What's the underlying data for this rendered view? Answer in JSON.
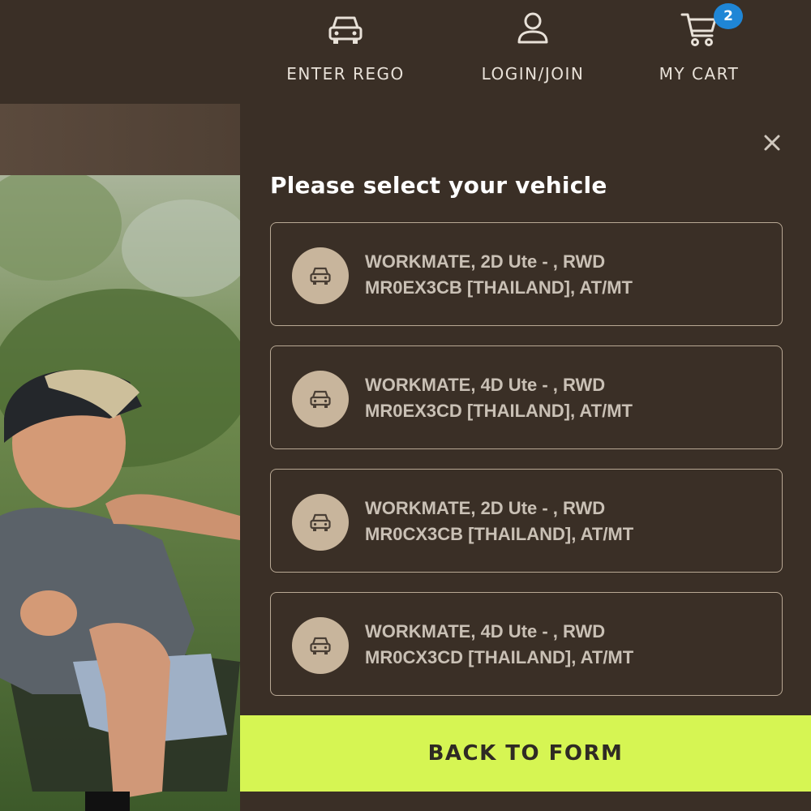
{
  "header": {
    "nav": [
      {
        "label": "ENTER REGO",
        "icon": "car-icon"
      },
      {
        "label": "LOGIN/JOIN",
        "icon": "user-icon"
      },
      {
        "label": "MY CART",
        "icon": "cart-icon",
        "badge": "2"
      }
    ]
  },
  "panel": {
    "title": "Please select your vehicle",
    "close_icon": "close-icon",
    "vehicles": [
      {
        "line1": "WORKMATE, 2D Ute - , RWD",
        "line2": "MR0EX3CB [THAILAND], AT/MT"
      },
      {
        "line1": "WORKMATE, 4D Ute - , RWD",
        "line2": "MR0EX3CD [THAILAND], AT/MT"
      },
      {
        "line1": "WORKMATE, 2D Ute - , RWD",
        "line2": "MR0CX3CB [THAILAND], AT/MT"
      },
      {
        "line1": "WORKMATE, 4D Ute - , RWD",
        "line2": "MR0CX3CD [THAILAND], AT/MT"
      }
    ],
    "back_button": "BACK TO FORM"
  },
  "colors": {
    "background": "#3a2f26",
    "accent_button": "#d6f553",
    "badge": "#1f86d6",
    "vehicle_icon_bg": "#c8b59c"
  }
}
